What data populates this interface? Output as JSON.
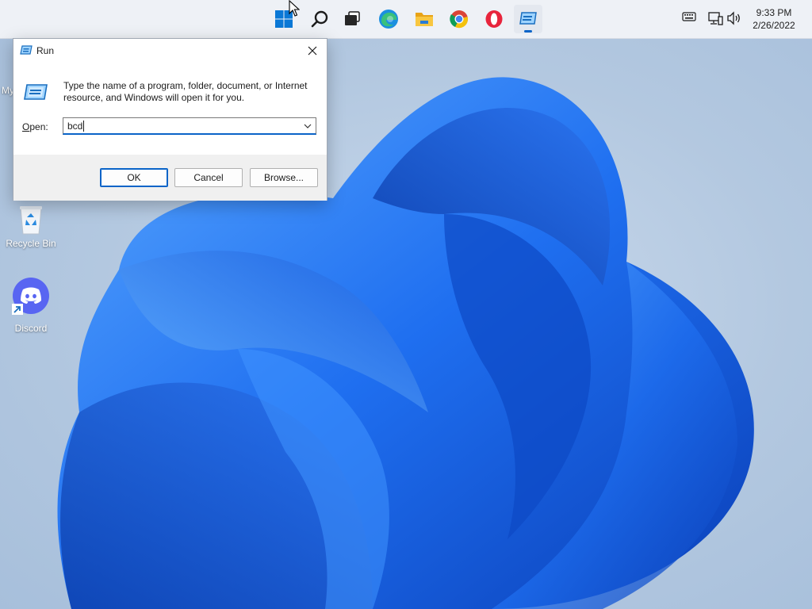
{
  "run_dialog": {
    "title": "Run",
    "description": "Type the name of a program, folder, document, or Internet resource, and Windows will open it for you.",
    "open_label_first": "O",
    "open_label_rest": "pen:",
    "open_value": "bcd",
    "buttons": {
      "ok": "OK",
      "cancel": "Cancel",
      "browse": "Browse..."
    }
  },
  "desktop": {
    "partial_icon_label": "My",
    "icons": [
      {
        "label": "Recycle Bin",
        "icon": "recycle-bin-icon"
      },
      {
        "label": "Discord",
        "icon": "discord-icon"
      }
    ]
  },
  "taskbar": {
    "apps": [
      {
        "icon": "windows-start-icon"
      },
      {
        "icon": "search-icon"
      },
      {
        "icon": "task-view-icon"
      },
      {
        "icon": "edge-icon"
      },
      {
        "icon": "file-explorer-icon"
      },
      {
        "icon": "chrome-icon"
      },
      {
        "icon": "opera-icon"
      },
      {
        "icon": "run-app-icon"
      }
    ],
    "tray": {
      "time": "9:33 PM",
      "date": "2/26/2022"
    }
  },
  "colors": {
    "accent": "#0a64c8",
    "wallpaper_blue": "#1e63e6",
    "discord": "#5865f2"
  }
}
